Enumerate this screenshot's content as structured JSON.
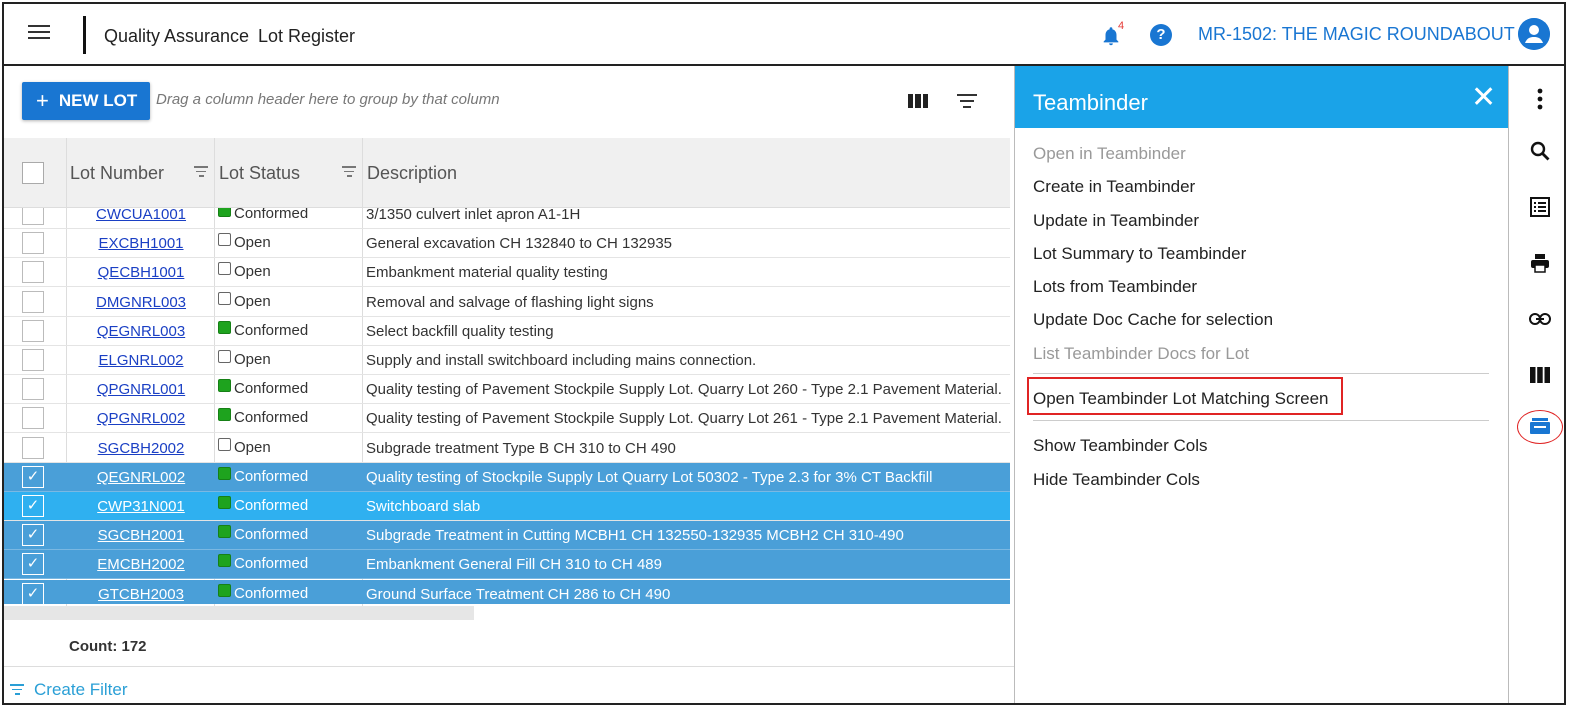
{
  "header": {
    "breadcrumb_section": "Quality Assurance",
    "breadcrumb_page": "Lot Register",
    "notification_count": "4",
    "help_label": "?",
    "project": "MR-1502: THE MAGIC ROUNDABOUT"
  },
  "toolbar": {
    "new_lot_label": "NEW LOT",
    "new_lot_plus": "+",
    "group_hint": "Drag a column header here to group by that column"
  },
  "grid": {
    "columns": [
      "Lot Number",
      "Lot Status",
      "Description"
    ],
    "rows": [
      {
        "lot": "CWCUA1001",
        "status": "Conformed",
        "desc": "3/1350 culvert inlet apron A1-1H",
        "selected": false
      },
      {
        "lot": "EXCBH1001",
        "status": "Open",
        "desc": "General excavation CH 132840 to CH 132935",
        "selected": false
      },
      {
        "lot": "QECBH1001",
        "status": "Open",
        "desc": "Embankment material quality testing",
        "selected": false
      },
      {
        "lot": "DMGNRL003",
        "status": "Open",
        "desc": "Removal and salvage of flashing light signs",
        "selected": false
      },
      {
        "lot": "QEGNRL003",
        "status": "Conformed",
        "desc": "Select backfill quality testing",
        "selected": false
      },
      {
        "lot": "ELGNRL002",
        "status": "Open",
        "desc": "Supply and install switchboard including mains connection.",
        "selected": false
      },
      {
        "lot": "QPGNRL001",
        "status": "Conformed",
        "desc": "Quality testing of Pavement Stockpile Supply Lot. Quarry Lot 260 - Type 2.1 Pavement Material.",
        "selected": false
      },
      {
        "lot": "QPGNRL002",
        "status": "Conformed",
        "desc": "Quality testing of Pavement Stockpile Supply Lot. Quarry Lot 261 - Type 2.1 Pavement Material.",
        "selected": false
      },
      {
        "lot": "SGCBH2002",
        "status": "Open",
        "desc": "Subgrade treatment Type B CH 310 to CH 490",
        "selected": false
      },
      {
        "lot": "QEGNRL002",
        "status": "Conformed",
        "desc": "Quality testing of Stockpile Supply Lot Quarry Lot 50302 - Type 2.3 for 3% CT Backfill",
        "selected": true
      },
      {
        "lot": "CWP31N001",
        "status": "Conformed",
        "desc": "Switchboard slab",
        "selected": true
      },
      {
        "lot": "SGCBH2001",
        "status": "Conformed",
        "desc": "Subgrade Treatment in Cutting MCBH1 CH 132550-132935 MCBH2 CH 310-490",
        "selected": true
      },
      {
        "lot": "EMCBH2002",
        "status": "Conformed",
        "desc": "Embankment General Fill CH 310 to CH 489",
        "selected": true
      },
      {
        "lot": "GTCBH2003",
        "status": "Conformed",
        "desc": "Ground Surface Treatment CH 286 to CH 490",
        "selected": true
      }
    ],
    "count_label": "Count: 172",
    "create_filter_label": "Create Filter"
  },
  "panel": {
    "title": "Teambinder",
    "close": "✕",
    "items": [
      {
        "label": "Open in Teambinder",
        "disabled": true
      },
      {
        "label": "Create in Teambinder",
        "disabled": false
      },
      {
        "label": "Update in Teambinder",
        "disabled": false
      },
      {
        "label": "Lot Summary to Teambinder",
        "disabled": false
      },
      {
        "label": "Lots from Teambinder",
        "disabled": false
      },
      {
        "label": "Update Doc Cache for selection",
        "disabled": false
      },
      {
        "label": "List Teambinder Docs for Lot",
        "disabled": true
      },
      {
        "label": "Open Teambinder Lot Matching Screen",
        "disabled": false
      },
      {
        "label": "Show Teambinder Cols",
        "disabled": false
      },
      {
        "label": "Hide Teambinder Cols",
        "disabled": false
      }
    ]
  },
  "sidebar_icons": [
    "more-vert-icon",
    "search-icon",
    "list-icon",
    "print-icon",
    "link-icon",
    "columns-icon",
    "teambinder-icon"
  ],
  "colors": {
    "accent": "#1976d2",
    "panel_header": "#1aa3e8",
    "selected_row": "#4a9fd8",
    "conformed": "#1ea31e",
    "highlight": "#e02424"
  }
}
